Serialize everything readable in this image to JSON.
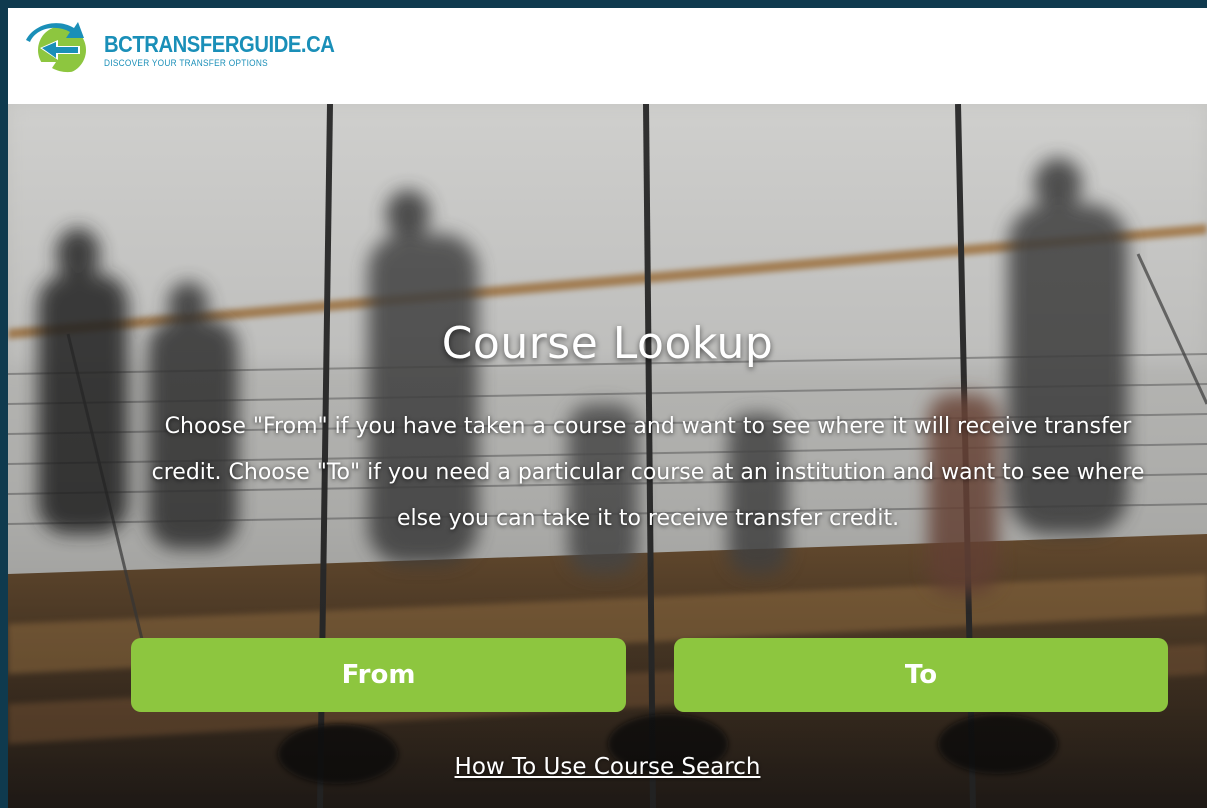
{
  "header": {
    "logo_title": "BCTRANSFERGUIDE.CA",
    "logo_tagline": "DISCOVER YOUR TRANSFER OPTIONS",
    "brand_blue": "#1a8fb8",
    "brand_green": "#8dc63f"
  },
  "hero": {
    "title": "Course Lookup",
    "description": "Choose \"From\" if you have taken a course and want to see where it will receive transfer credit. Choose \"To\" if you need a particular course at an institution and want to see where else you can take it to receive transfer credit.",
    "from_label": "From",
    "to_label": "To",
    "howto_link": "How To Use Course Search",
    "button_color": "#8dc63f"
  }
}
